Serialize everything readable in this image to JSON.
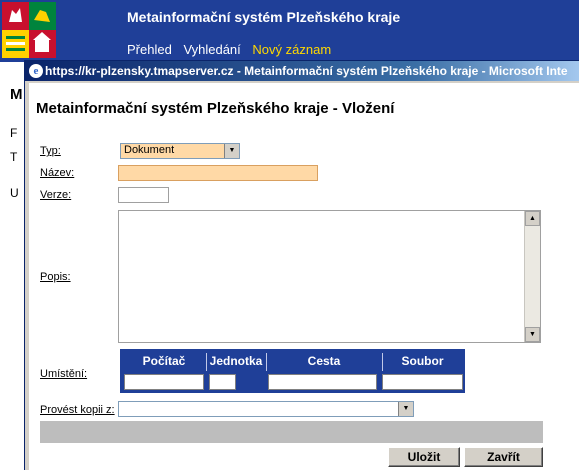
{
  "background": {
    "app_title": "Metainformační systém Plzeňského kraje",
    "nav": {
      "overview": "Přehled",
      "search": "Vyhledání",
      "new_record": "Nový záznam"
    },
    "left_fragments": [
      "M",
      "F",
      "T",
      "U"
    ],
    "colors": {
      "header_bg": "#1f3f98",
      "nav_active": "#ffd800",
      "nav_text": "#ffffff"
    }
  },
  "window": {
    "titlebar": "https://kr-plzensky.tmapserver.cz - Metainformační systém Plzeňského kraje - Microsoft Inte",
    "heading": "Metainformační systém Plzeňského kraje - Vložení",
    "icon": "ie-icon"
  },
  "form": {
    "type_label": "Typ:",
    "type_value": "Dokument",
    "name_label": "Název:",
    "name_value": "",
    "version_label": "Verze:",
    "version_value": "",
    "description_label": "Popis:",
    "description_value": "",
    "location_label": "Umístění:",
    "location_headers": [
      "Počítač",
      "Jednotka",
      "Cesta",
      "Soubor"
    ],
    "copy_label": "Provést kopii z:",
    "copy_value": "",
    "colors": {
      "required_field": "#ffd9a6",
      "location_header": "#1f3f98"
    }
  },
  "buttons": {
    "save": "Uložit",
    "close": "Zavřít"
  }
}
